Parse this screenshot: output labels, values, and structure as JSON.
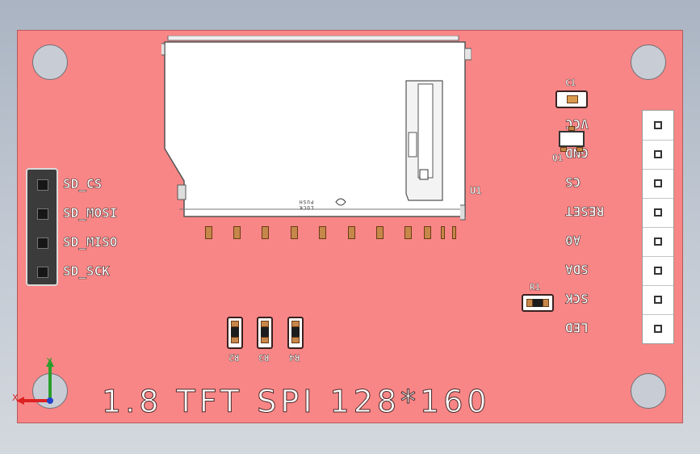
{
  "board": {
    "title": "1.8  TFT  SPI  128*160"
  },
  "sd_header": {
    "labels": [
      "SD_CS",
      "SD_MOSI",
      "SD_MISO",
      "SD_SCK"
    ]
  },
  "lcd_header": {
    "labels": [
      "VCC",
      "GND",
      "CS",
      "RESET",
      "A0",
      "SDA",
      "SCK",
      "LED"
    ]
  },
  "refs": {
    "u1": "U1",
    "c1": "C1",
    "q1": "Q1",
    "r1": "R1",
    "r2": "R2",
    "r3": "R3",
    "r4": "R4",
    "socket_marking": "LOCK\nPUSH"
  },
  "axis": {
    "x": "X",
    "y": "Y"
  },
  "colors": {
    "pcb": "#f98686",
    "silkscreen": "#ffffff",
    "pad": "#c6874a"
  }
}
